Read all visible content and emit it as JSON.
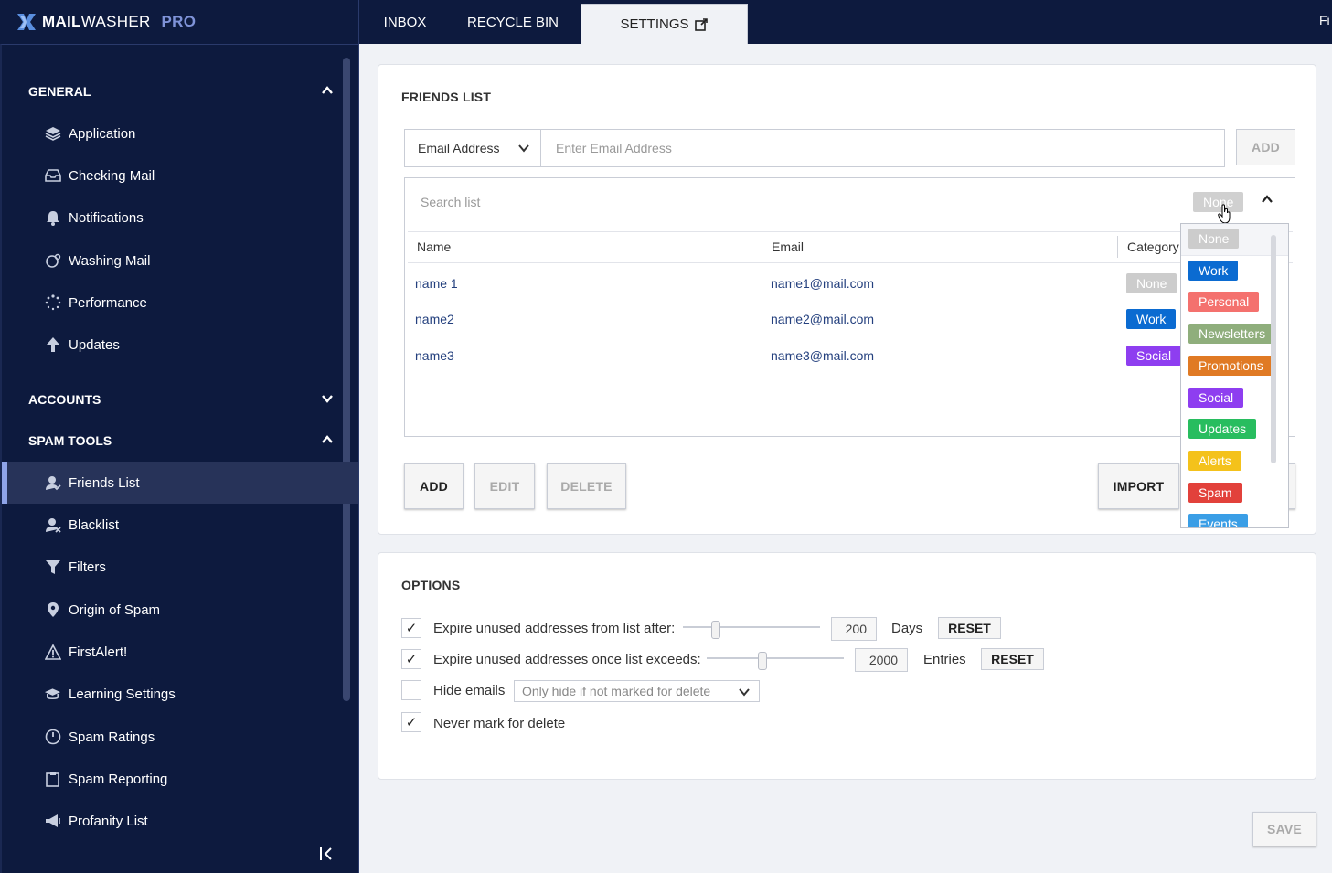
{
  "app": {
    "brand_a": "MAIL",
    "brand_b": "WASHER",
    "brand_c": "PRO",
    "top_right_truncated": "Fi"
  },
  "tabs": [
    {
      "label": "INBOX"
    },
    {
      "label": "RECYCLE BIN"
    },
    {
      "label": "SETTINGS"
    }
  ],
  "sidebar": {
    "general": {
      "label": "GENERAL",
      "items": [
        {
          "label": "Application",
          "icon": "layers-icon"
        },
        {
          "label": "Checking Mail",
          "icon": "inbox-icon"
        },
        {
          "label": "Notifications",
          "icon": "bell-icon"
        },
        {
          "label": "Washing Mail",
          "icon": "wash-icon"
        },
        {
          "label": "Performance",
          "icon": "spinner-icon"
        },
        {
          "label": "Updates",
          "icon": "arrow-up-icon"
        }
      ]
    },
    "accounts": {
      "label": "ACCOUNTS"
    },
    "spam_tools": {
      "label": "SPAM TOOLS",
      "items": [
        {
          "label": "Friends List",
          "icon": "friend-user-icon"
        },
        {
          "label": "Blacklist",
          "icon": "blocked-user-icon"
        },
        {
          "label": "Filters",
          "icon": "filter-icon"
        },
        {
          "label": "Origin of Spam",
          "icon": "map-pin-icon"
        },
        {
          "label": "FirstAlert!",
          "icon": "warning-icon"
        },
        {
          "label": "Learning Settings",
          "icon": "graduation-cap-icon"
        },
        {
          "label": "Spam Ratings",
          "icon": "gauge-icon"
        },
        {
          "label": "Spam Reporting",
          "icon": "clipboard-icon"
        },
        {
          "label": "Profanity List",
          "icon": "megaphone-icon"
        }
      ]
    }
  },
  "friends_list": {
    "title": "FRIENDS LIST",
    "type_select": "Email Address",
    "email_placeholder": "Enter Email Address",
    "add_top": "ADD",
    "search_placeholder": "Search list",
    "filter_value": "None",
    "columns": {
      "name": "Name",
      "email": "Email",
      "category": "Category"
    },
    "rows": [
      {
        "name": "name 1",
        "email": "name1@mail.com",
        "category": "None"
      },
      {
        "name": "name2",
        "email": "name2@mail.com",
        "category": "Work"
      },
      {
        "name": "name3",
        "email": "name3@mail.com",
        "category": "Social"
      }
    ],
    "buttons": {
      "add": "ADD",
      "edit": "EDIT",
      "delete": "DELETE",
      "import": "IMPORT"
    }
  },
  "category_dropdown": [
    {
      "label": "None",
      "color": "#cccccc"
    },
    {
      "label": "Work",
      "color": "#0b6bd1"
    },
    {
      "label": "Personal",
      "color": "#f4716e"
    },
    {
      "label": "Newsletters",
      "color": "#8fae7c"
    },
    {
      "label": "Promotions",
      "color": "#e07a24"
    },
    {
      "label": "Social",
      "color": "#8e3ef0"
    },
    {
      "label": "Updates",
      "color": "#28bd5f"
    },
    {
      "label": "Alerts",
      "color": "#f4c21b"
    },
    {
      "label": "Spam",
      "color": "#e2413b"
    },
    {
      "label": "Events",
      "color": "#3a9ee6"
    }
  ],
  "options": {
    "title": "OPTIONS",
    "expire_after": {
      "label": "Expire unused addresses from list after:",
      "value": "200",
      "unit": "Days",
      "reset": "RESET",
      "checked": true,
      "slider_fraction": 0.22
    },
    "expire_exceeds": {
      "label": "Expire unused addresses once list exceeds:",
      "value": "2000",
      "unit": "Entries",
      "reset": "RESET",
      "checked": true,
      "slider_fraction": 0.4
    },
    "hide_emails": {
      "label": "Hide emails",
      "select": "Only hide if not marked for delete",
      "checked": false
    },
    "never_mark": {
      "label": "Never mark for delete",
      "checked": true
    }
  },
  "save": "SAVE",
  "colors": {
    "sidebar_bg": "#0d1a3e",
    "accent": "#8fa4e8",
    "link": "#24407e"
  }
}
